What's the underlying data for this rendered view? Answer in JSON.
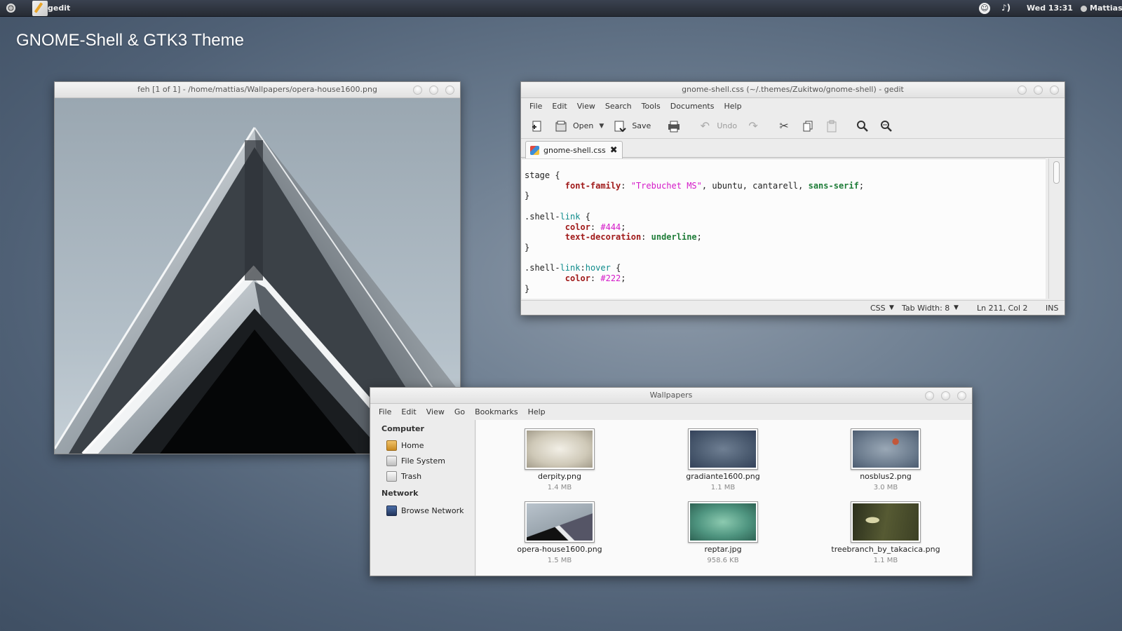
{
  "panel": {
    "app_name": "gedit",
    "a11y_glyph": "☺",
    "volume_glyph": "♪)",
    "clock": "Wed 13:31",
    "user": "Mattias"
  },
  "desktop_title": "GNOME-Shell & GTK3 Theme",
  "feh": {
    "title": "feh [1 of 1] - /home/mattias/Wallpapers/opera-house1600.png"
  },
  "gedit": {
    "title": "gnome-shell.css (~/.themes/Zukitwo/gnome-shell) - gedit",
    "menu": [
      "File",
      "Edit",
      "View",
      "Search",
      "Tools",
      "Documents",
      "Help"
    ],
    "toolbar": {
      "open_label": "Open",
      "save_label": "Save",
      "undo_label": "Undo"
    },
    "tab": {
      "label": "gnome-shell.css",
      "close_glyph": "✖"
    },
    "status": {
      "language": "CSS",
      "tab_width": "Tab Width:  8",
      "position": "Ln 211, Col 2",
      "mode": "INS"
    }
  },
  "files": {
    "title": "Wallpapers",
    "menu": [
      "File",
      "Edit",
      "View",
      "Go",
      "Bookmarks",
      "Help"
    ],
    "sidebar": {
      "computer_heading": "Computer",
      "network_heading": "Network",
      "items": [
        {
          "label": "Home",
          "icon": "home-folder-icon"
        },
        {
          "label": "File System",
          "icon": "drive-icon"
        },
        {
          "label": "Trash",
          "icon": "trash-icon"
        },
        {
          "label": "Browse Network",
          "icon": "network-icon"
        }
      ]
    },
    "items": [
      {
        "name": "derpity.png",
        "size": "1.4 MB"
      },
      {
        "name": "gradiante1600.png",
        "size": "1.1 MB"
      },
      {
        "name": "nosblus2.png",
        "size": "3.0 MB"
      },
      {
        "name": "opera-house1600.png",
        "size": "1.5 MB"
      },
      {
        "name": "reptar.jpg",
        "size": "958.6 KB"
      },
      {
        "name": "treebranch_by_takacica.png",
        "size": "1.1 MB"
      }
    ]
  },
  "colors": {
    "css_property": "#a01a1a",
    "css_string": "#d418c8",
    "css_value": "#1f7d39",
    "css_selector_part": "#0d8b8b"
  }
}
